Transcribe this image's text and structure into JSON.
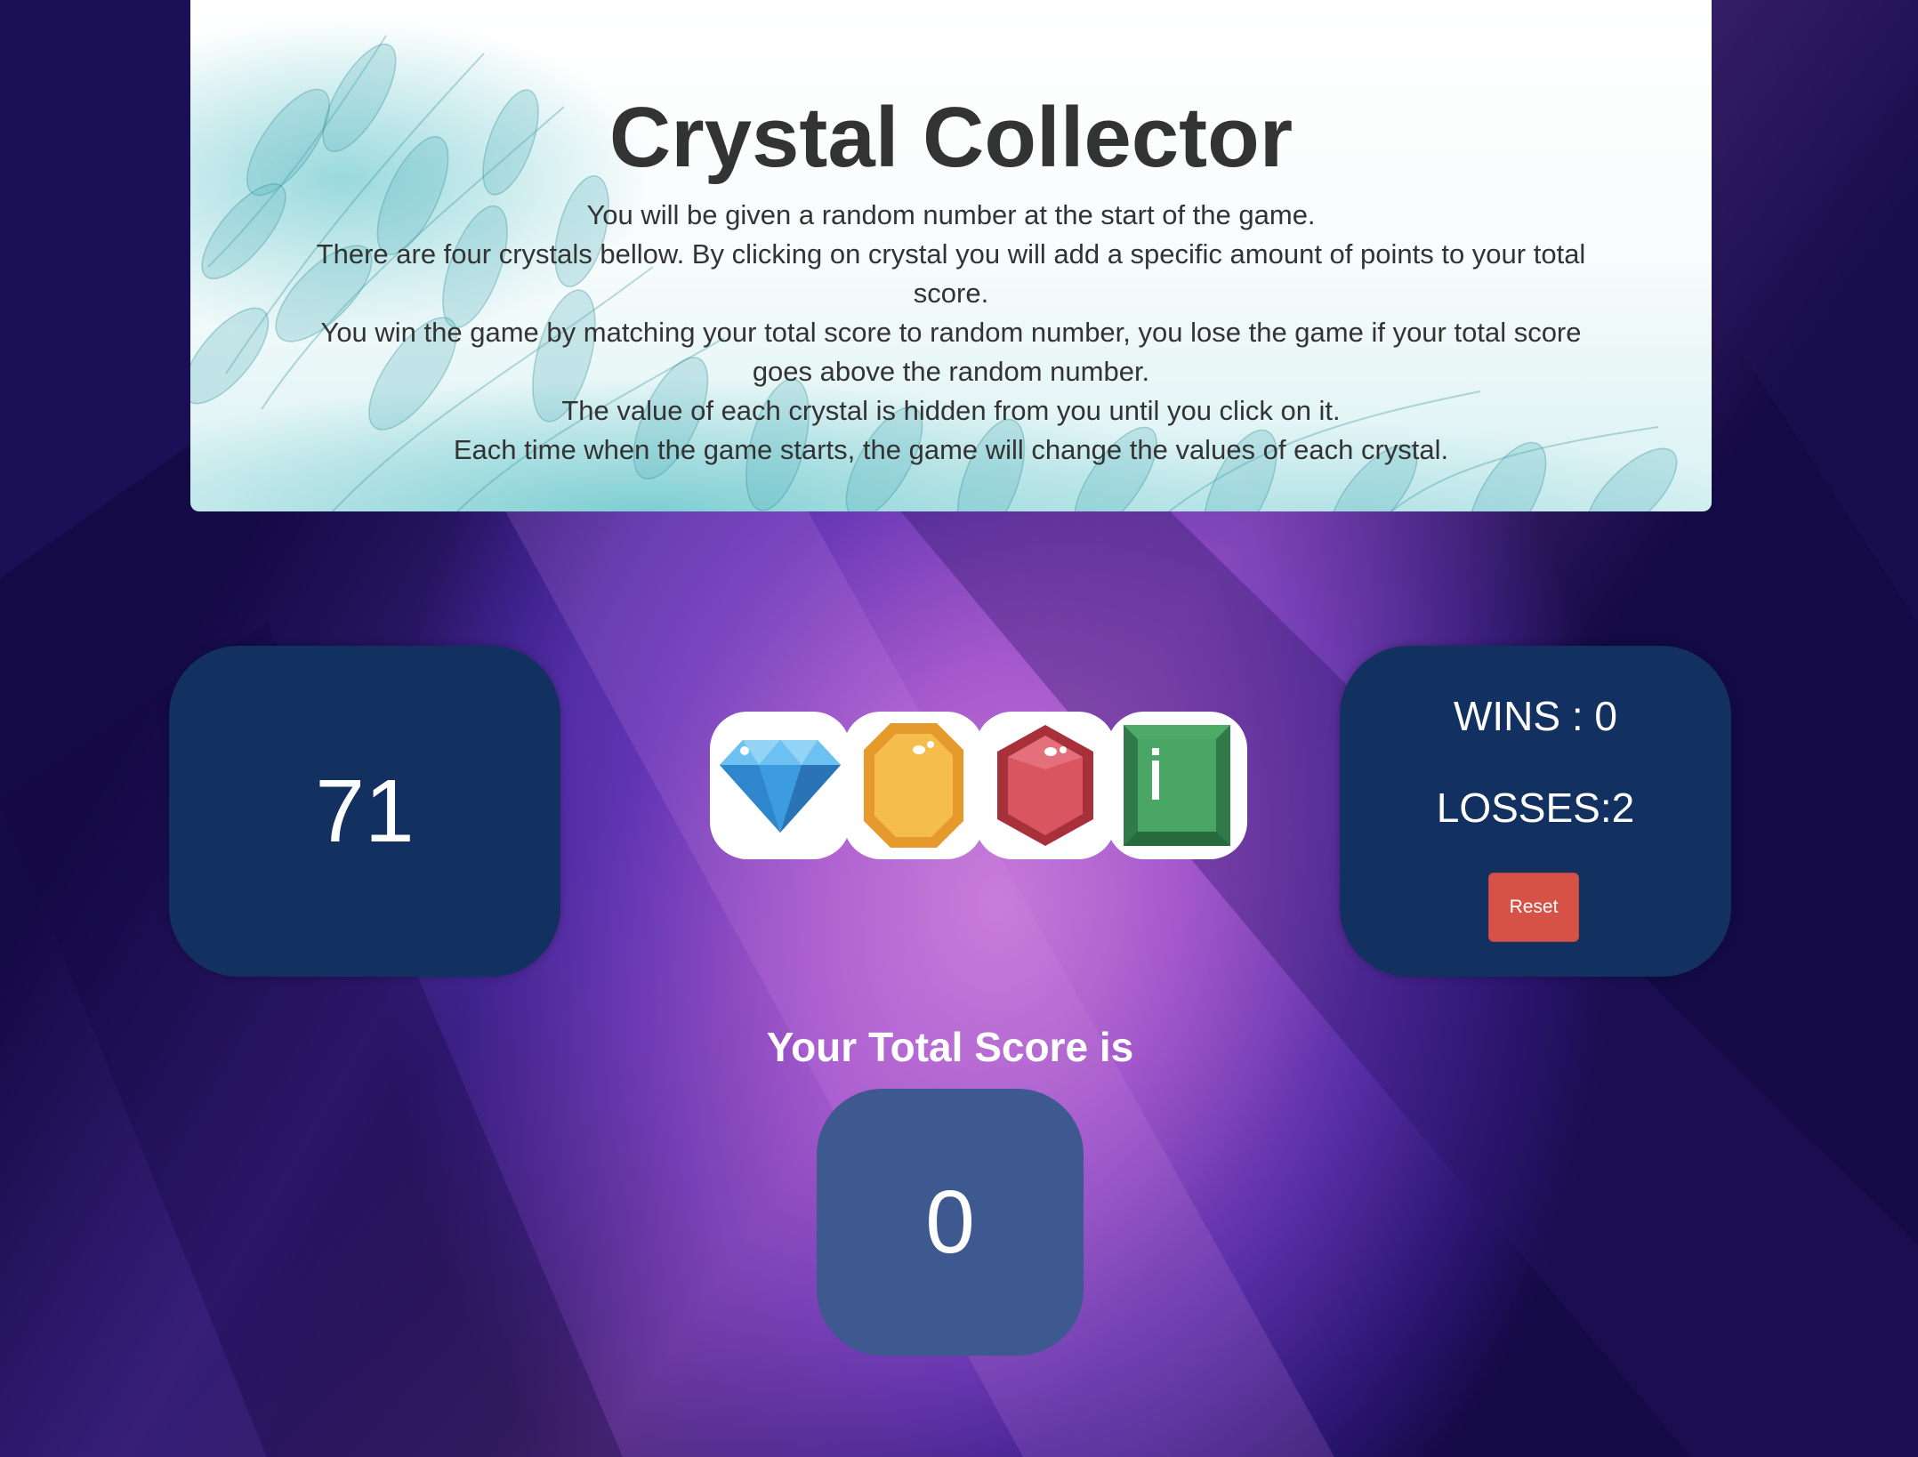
{
  "header": {
    "title": "Crystal Collector",
    "instructions": [
      "You will be given a random number at the start of the game.",
      "There are four crystals bellow. By clicking on crystal you will add a specific amount of points to your total score.",
      "You win the game by matching your total score to random number, you lose the game if your total score goes above the random number.",
      "The value of each crystal is hidden from you until you click on it.",
      "Each time when the game starts, the game will change the values of each crystal."
    ]
  },
  "target": {
    "value": "71"
  },
  "stats": {
    "wins_text": "WINS : 0",
    "losses_text": "LOSSES:2",
    "reset_label": "Reset"
  },
  "crystals": [
    {
      "icon": "blue-diamond-icon",
      "color": "#3d9be0"
    },
    {
      "icon": "yellow-gem-icon",
      "color": "#f2b53e"
    },
    {
      "icon": "red-gem-icon",
      "color": "#d0434f"
    },
    {
      "icon": "green-gem-icon",
      "color": "#3f9a5a"
    }
  ],
  "score": {
    "label": "Your Total Score is",
    "value": "0"
  },
  "colors": {
    "panel": "#123160",
    "score_panel": "#3e5890",
    "reset_button": "#d65247"
  }
}
